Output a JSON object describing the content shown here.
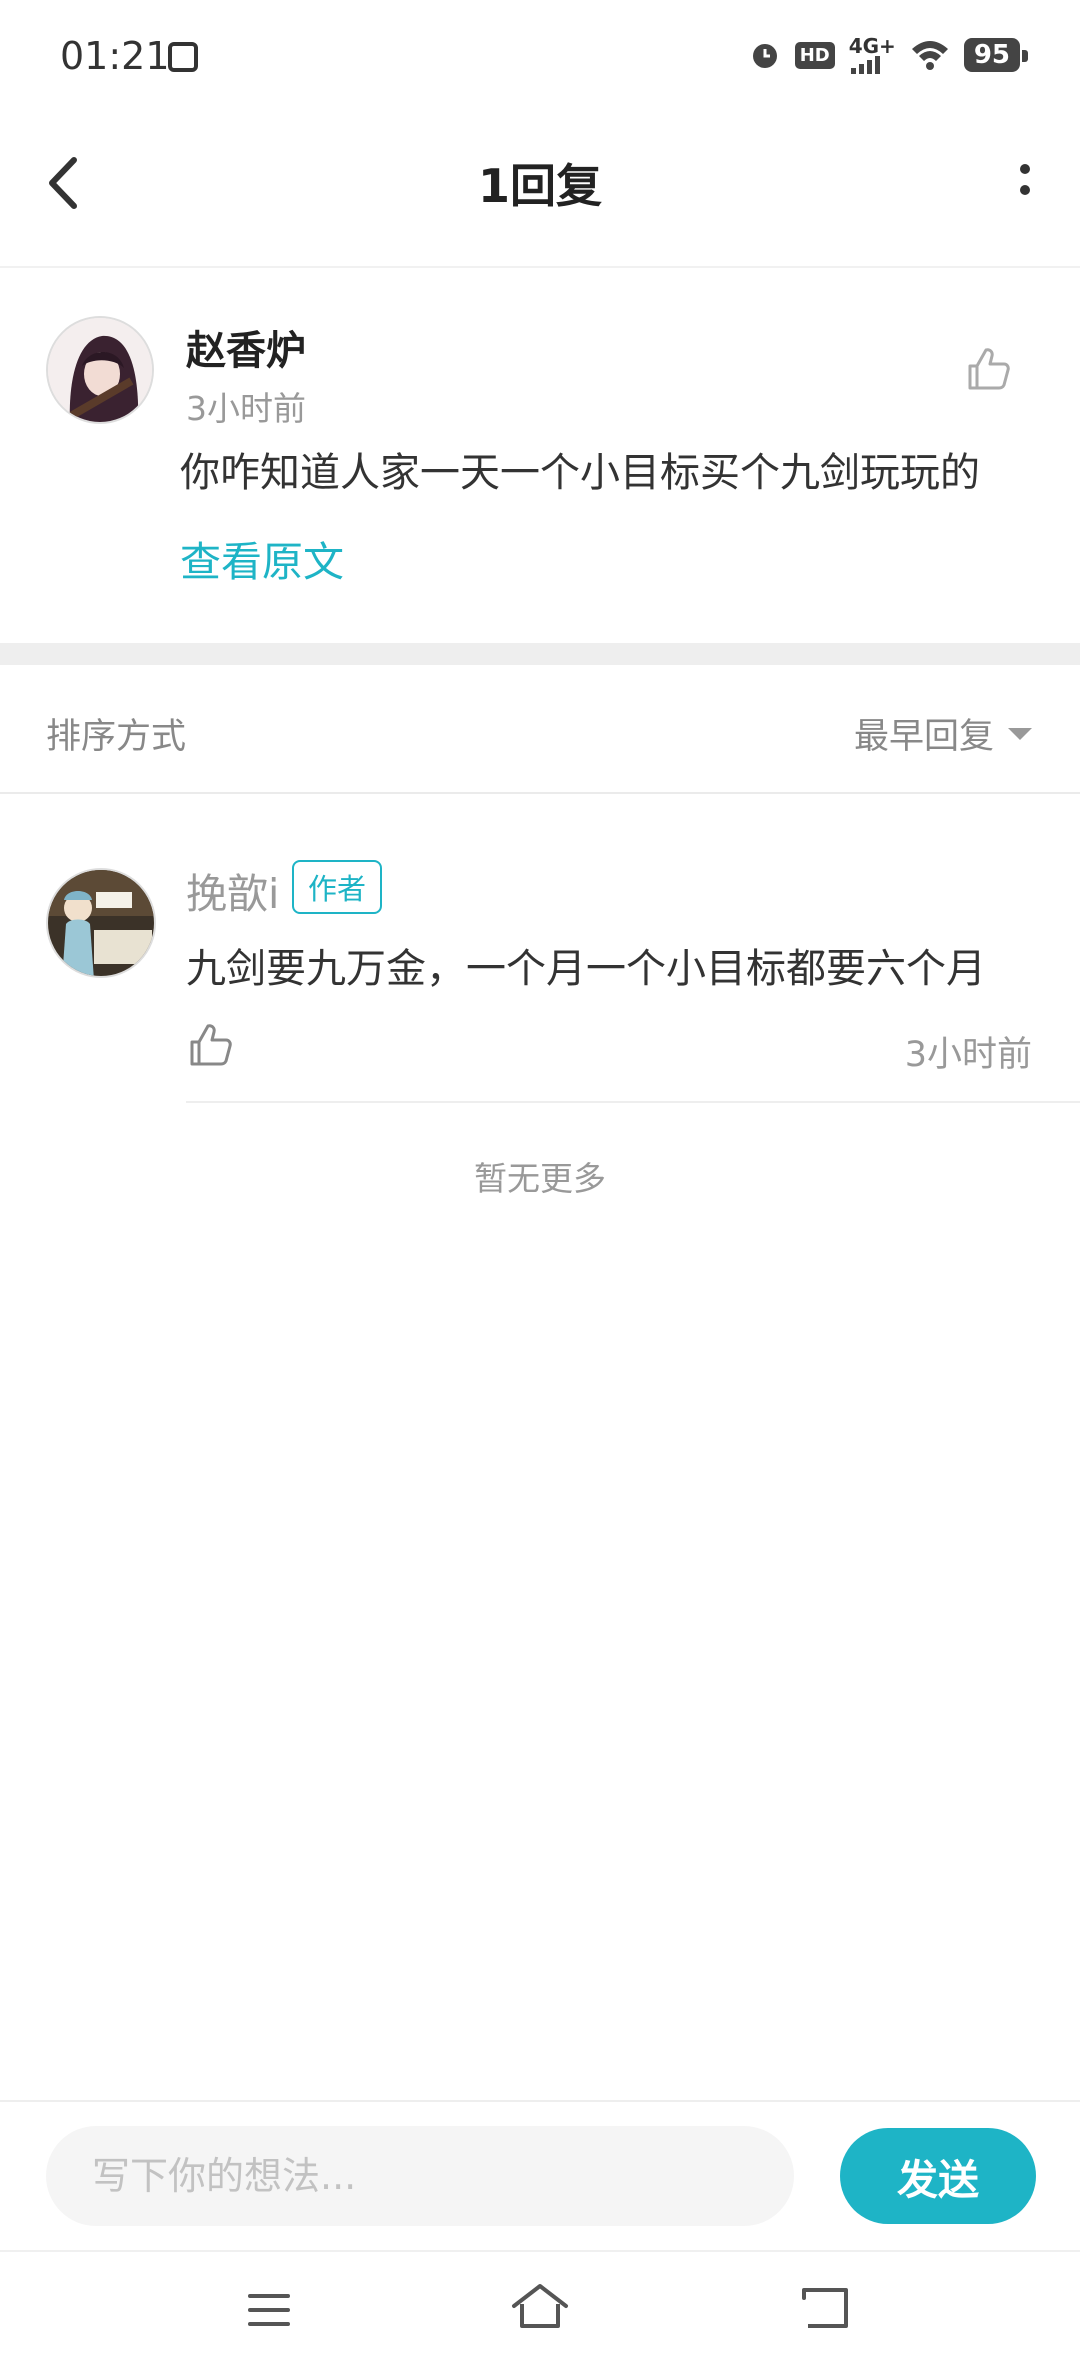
{
  "status_bar": {
    "time": "01:21",
    "hd": "HD",
    "network": "4G+",
    "battery": "95"
  },
  "header": {
    "title": "1回复"
  },
  "original_post": {
    "author": "赵香炉",
    "time": "3小时前",
    "content": "你咋知道人家一天一个小目标买个九剑玩玩的",
    "view_original": "查看原文"
  },
  "sort": {
    "label": "排序方式",
    "selected": "最早回复"
  },
  "replies": [
    {
      "author": "挽歆i",
      "badge": "作者",
      "content": "九剑要九万金，一个月一个小目标都要六个月",
      "time": "3小时前"
    }
  ],
  "no_more": "暂无更多",
  "input": {
    "placeholder": "写下你的想法...",
    "send_label": "发送"
  },
  "colors": {
    "accent": "#1eb4c6",
    "muted_text": "#999999",
    "section_gap": "#eeeeee"
  }
}
